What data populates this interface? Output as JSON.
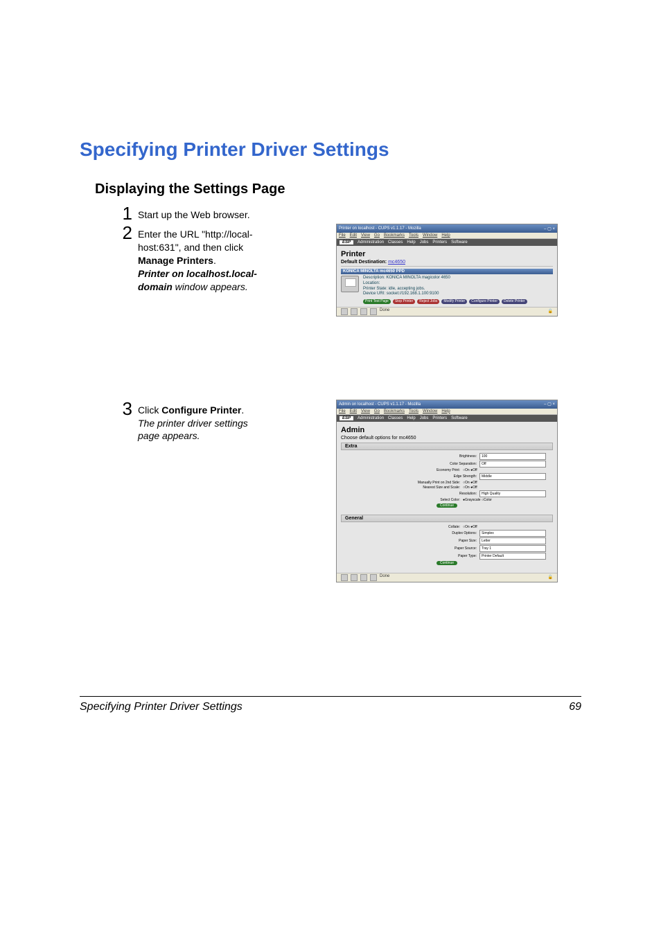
{
  "page": {
    "title": "Specifying Printer Driver Settings",
    "section": "Displaying the Settings Page",
    "footer_text": "Specifying Printer Driver Settings",
    "page_number": "69"
  },
  "steps": [
    {
      "num": "1",
      "html": "Start up the Web browser."
    },
    {
      "num": "2",
      "line1": "Enter the URL \"http://local-",
      "line2": "host:631\", and then click ",
      "bold1": "Manage Printers",
      "period": ".",
      "bi1": "Printer on localhost.local-",
      "bi2": "domain",
      "it_suffix": " window appears."
    },
    {
      "num": "3",
      "prefix": "Click ",
      "bold": "Configure Printer",
      "period": ".",
      "it1": "The printer driver settings ",
      "it2": "page appears."
    }
  ],
  "screenshot1": {
    "window_title": "Printer on localhost - CUPS v1.1.17 - Mozilla",
    "menus": [
      "File",
      "Edit",
      "View",
      "Go",
      "Bookmarks",
      "Tools",
      "Window",
      "Help"
    ],
    "nav": {
      "esp": "ESP",
      "items": [
        "Administration",
        "Classes",
        "Help",
        "Jobs",
        "Printers",
        "Software"
      ]
    },
    "heading": "Printer",
    "default_dest_label": "Default Destination:",
    "default_dest_value": "mc4650",
    "printer_name": "KONICA MINOLTA mc4650 PPD",
    "desc_label": "Description:",
    "desc_value": "KONICA MINOLTA magicolor 4650",
    "loc_label": "Location:",
    "state_label": "Printer State:",
    "state_value": "idle, accepting jobs.",
    "device_label": "Device URI:",
    "device_value": "socket://192.168.1.100:9100",
    "buttons": [
      "Print Test Page",
      "Stop Printer",
      "Reject Jobs",
      "Modify Printer",
      "Configure Printer",
      "Delete Printer"
    ],
    "status": "Done"
  },
  "screenshot2": {
    "window_title": "Admin on localhost - CUPS v1.1.17 - Mozilla",
    "menus": [
      "File",
      "Edit",
      "View",
      "Go",
      "Bookmarks",
      "Tools",
      "Window",
      "Help"
    ],
    "nav": {
      "esp": "ESP",
      "items": [
        "Administration",
        "Classes",
        "Help",
        "Jobs",
        "Printers",
        "Software"
      ]
    },
    "heading": "Admin",
    "subheading": "Choose default options for mc4650",
    "sections": {
      "extra": {
        "title": "Extra",
        "rows": [
          {
            "label": "Brightness:",
            "value": "100"
          },
          {
            "label": "Color Separation:",
            "value": "Off"
          },
          {
            "label": "Economy Print:",
            "value": "○On ●Off"
          },
          {
            "label": "Edge Strength:",
            "value": "Middle"
          },
          {
            "label": "Manually Print on 2nd Side:",
            "value": "○On ●Off"
          },
          {
            "label": "Nearest Size and Scale:",
            "value": "○On ●Off"
          },
          {
            "label": "Resolution:",
            "value": "High Quality"
          },
          {
            "label": "Select Color:",
            "value": "●Grayscale ○Color"
          }
        ],
        "continue": "Continue"
      },
      "general": {
        "title": "General",
        "rows": [
          {
            "label": "Collate:",
            "value": "○On ●Off"
          },
          {
            "label": "Duplex Options:",
            "value": "Simplex"
          },
          {
            "label": "Paper Size:",
            "value": "Letter"
          },
          {
            "label": "Paper Source:",
            "value": "Tray 1"
          },
          {
            "label": "Paper Type:",
            "value": "Printer Default"
          }
        ],
        "continue": "Continue"
      }
    },
    "status": "Done"
  }
}
